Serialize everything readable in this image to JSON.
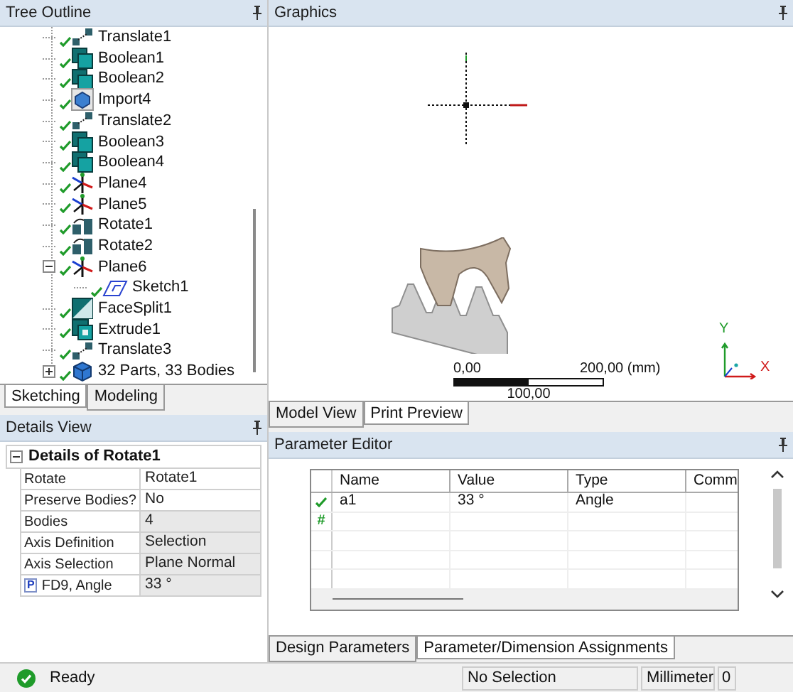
{
  "tree_outline": {
    "title": "Tree Outline",
    "items": [
      {
        "label": "Translate1",
        "kind": "translate"
      },
      {
        "label": "Boolean1",
        "kind": "boolean"
      },
      {
        "label": "Boolean2",
        "kind": "boolean"
      },
      {
        "label": "Import4",
        "kind": "import"
      },
      {
        "label": "Translate2",
        "kind": "translate"
      },
      {
        "label": "Boolean3",
        "kind": "boolean"
      },
      {
        "label": "Boolean4",
        "kind": "boolean"
      },
      {
        "label": "Plane4",
        "kind": "plane"
      },
      {
        "label": "Plane5",
        "kind": "plane"
      },
      {
        "label": "Rotate1",
        "kind": "rotate"
      },
      {
        "label": "Rotate2",
        "kind": "rotate"
      },
      {
        "label": "Plane6",
        "kind": "plane",
        "expanded": true,
        "children": [
          {
            "label": "Sketch1",
            "kind": "sketch"
          }
        ]
      },
      {
        "label": "FaceSplit1",
        "kind": "facesplit"
      },
      {
        "label": "Extrude1",
        "kind": "extrude"
      },
      {
        "label": "Translate3",
        "kind": "translate"
      },
      {
        "label": "32 Parts, 33 Bodies",
        "kind": "parts",
        "expanded": false
      }
    ],
    "tabs": [
      {
        "label": "Sketching",
        "selected": false
      },
      {
        "label": "Modeling",
        "selected": true
      }
    ]
  },
  "details_view": {
    "title": "Details View",
    "group": "Details of Rotate1",
    "expanded": true,
    "rows": [
      {
        "label": "Rotate",
        "value": "Rotate1",
        "readonly": false
      },
      {
        "label": "Preserve Bodies?",
        "value": "No",
        "readonly": false
      },
      {
        "label": "Bodies",
        "value": "4",
        "readonly": true
      },
      {
        "label": "Axis Definition",
        "value": "Selection",
        "readonly": true
      },
      {
        "label": "Axis Selection",
        "value": "Plane Normal",
        "readonly": true
      },
      {
        "label": "FD9, Angle",
        "value": "33 °",
        "readonly": true,
        "badge": "P"
      }
    ]
  },
  "graphics": {
    "title": "Graphics",
    "scale_bar": {
      "start": "0,00",
      "end": "200,00 (mm)",
      "middle": "100,00"
    },
    "axes": {
      "y": "Y",
      "x": "X"
    },
    "tabs": [
      {
        "label": "Model View",
        "selected": true
      },
      {
        "label": "Print Preview",
        "selected": false
      }
    ]
  },
  "parameter_editor": {
    "title": "Parameter Editor",
    "columns": [
      "Name",
      "Value",
      "Type",
      "Comm"
    ],
    "rows": [
      {
        "kind": "valid",
        "cells": [
          "a1",
          "33 °",
          "Angle"
        ]
      },
      {
        "kind": "new",
        "marker": "#",
        "cells": []
      }
    ],
    "tabs": [
      {
        "label": "Design Parameters",
        "selected": true
      },
      {
        "label": "Parameter/Dimension Assignments",
        "selected": false
      }
    ]
  },
  "status_bar": {
    "message": "Ready",
    "selection": "No Selection",
    "units": "Millimeter",
    "fields": [
      "0"
    ]
  }
}
